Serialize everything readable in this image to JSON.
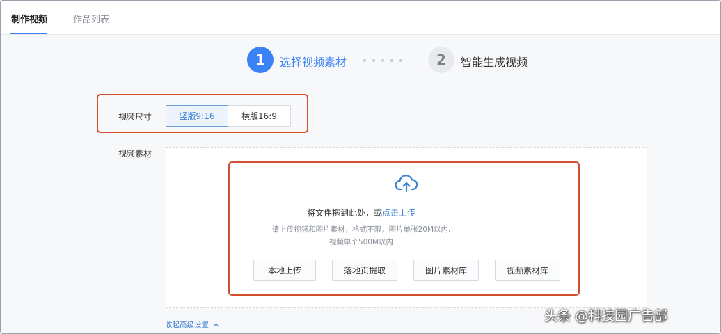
{
  "tabs": [
    {
      "label": "制作视频",
      "active": true
    },
    {
      "label": "作品列表",
      "active": false
    }
  ],
  "steps": [
    {
      "number": "1",
      "label": "选择视频素材",
      "active": true
    },
    {
      "number": "2",
      "label": "智能生成视频",
      "active": false
    }
  ],
  "video_size": {
    "label": "视频尺寸",
    "options": [
      "竖版9:16",
      "横版16:9"
    ],
    "selected": "竖版9:16"
  },
  "video_material": {
    "label": "视频素材",
    "upload_prompt": "将文件拖到此处，或",
    "upload_link": "点击上传",
    "hint_line1": "请上传视频和图片素材，格式不限，图片单张20M以内,",
    "hint_line2": "视频单个500M以内",
    "buttons": [
      "本地上传",
      "落地页提取",
      "图片素材库",
      "视频素材库"
    ]
  },
  "collapse_advanced": "收起高级设置",
  "watermark": "头条 @科技园广告部",
  "colors": {
    "accent": "#3b82f6",
    "highlight_border": "#d2502f"
  }
}
